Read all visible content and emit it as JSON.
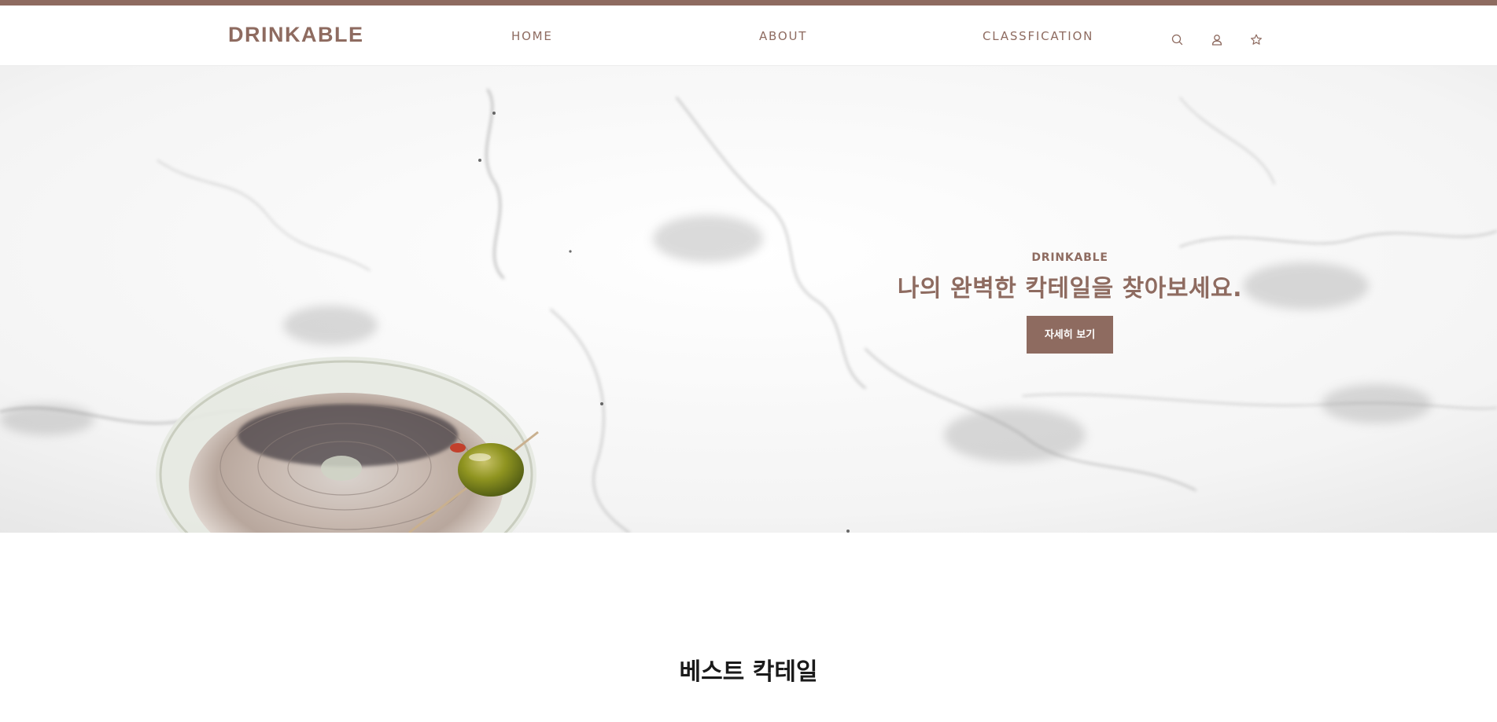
{
  "brand": {
    "logo_text": "DRINKABLE",
    "color_primary": "#8e6b60"
  },
  "nav": {
    "items": [
      {
        "label": "HOME"
      },
      {
        "label": "ABOUT"
      },
      {
        "label": "CLASSFICATION"
      }
    ],
    "icons": [
      "search-icon",
      "user-icon",
      "star-icon"
    ]
  },
  "hero": {
    "eyebrow": "DRINKABLE",
    "headline": "나의 완벽한 칵테일을 찾아보세요.",
    "button_label": "자세히 보기"
  },
  "best_section": {
    "title": "베스트 칵테일"
  }
}
